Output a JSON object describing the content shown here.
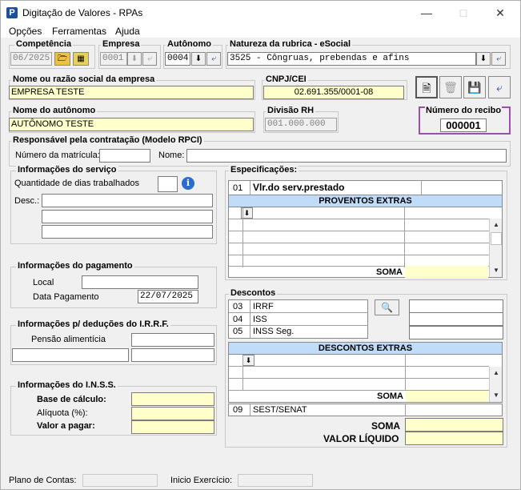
{
  "window": {
    "title": "Digitação de Valores - RPAs",
    "app_icon": "P"
  },
  "menu": [
    "Opções",
    "Ferramentas",
    "Ajuda"
  ],
  "top": {
    "competencia_label": "Competência",
    "competencia_value": "06/2025",
    "empresa_label": "Empresa",
    "empresa_value": "0001",
    "autonomo_label": "Autônomo",
    "autonomo_value": "0004",
    "natureza_label": "Natureza da rubrica - eSocial",
    "natureza_value": "3525 - Côngruas, prebendas e afins"
  },
  "empresa": {
    "nome_label": "Nome ou razão social da empresa",
    "nome_value": "EMPRESA TESTE",
    "cnpj_label": "CNPJ/CEI",
    "cnpj_value": "02.691.355/0001-08"
  },
  "autonomo": {
    "nome_label": "Nome do autônomo",
    "nome_value": "AUTÔNOMO TESTE",
    "divisao_label": "Divisão RH",
    "divisao_value": "001.000.000"
  },
  "recibo": {
    "label": "Número do recibo",
    "value": "000001"
  },
  "responsavel": {
    "title": "Responsável pela contratação (Modelo RPCI)",
    "matricula_label": "Número da matrícula:",
    "nome_label": "Nome:"
  },
  "servico": {
    "title": "Informações do serviço",
    "dias_label": "Quantidade de dias trabalhados",
    "desc_label": "Desc.:"
  },
  "pagamento": {
    "title": "Informações do pagamento",
    "local_label": "Local",
    "data_label": "Data Pagamento",
    "data_value": "22/07/2025"
  },
  "irrf": {
    "title": "Informações p/ deduções do I.R.R.F.",
    "pensao_label": "Pensão alimentícia"
  },
  "inss": {
    "title": "Informações do I.N.S.S.",
    "base_label": "Base de cálculo:",
    "aliquota_label": "Alíquota (%):",
    "valor_label": "Valor a pagar:"
  },
  "especificacoes": {
    "title": "Especificações:",
    "row_code": "01",
    "row_label": "Vlr.do serv.prestado",
    "proventos_header": "PROVENTOS EXTRAS",
    "soma_label": "SOMA"
  },
  "descontos": {
    "title": "Descontos",
    "rows": [
      {
        "code": "03",
        "label": "IRRF"
      },
      {
        "code": "04",
        "label": "ISS"
      },
      {
        "code": "05",
        "label": "INSS Seg."
      }
    ],
    "extras_header": "DESCONTOS EXTRAS",
    "soma_label": "SOMA",
    "sest_code": "09",
    "sest_label": "SEST/SENAT"
  },
  "totais": {
    "soma_label": "SOMA",
    "liquido_label": "VALOR LÍQUIDO"
  },
  "status": {
    "plano_label": "Plano de Contas:",
    "inicio_label": "Inicio Exercício:"
  }
}
